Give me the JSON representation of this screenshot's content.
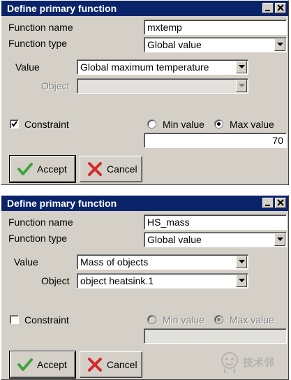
{
  "dialog1": {
    "title": "Define primary function",
    "function_name_label": "Function name",
    "function_name_value": "mxtemp",
    "function_type_label": "Function type",
    "function_type_value": "Global value",
    "value_label": "Value",
    "value_value": "Global maximum temperature",
    "object_label": "Object",
    "object_value": "",
    "object_enabled": false,
    "constraint_label": "Constraint",
    "constraint_checked": true,
    "min_value_label": "Min value",
    "max_value_label": "Max value",
    "selected_bound": "max",
    "bound_value": "70",
    "accept_label": "Accept",
    "cancel_label": "Cancel"
  },
  "dialog2": {
    "title": "Define primary function",
    "function_name_label": "Function name",
    "function_name_value": "HS_mass",
    "function_type_label": "Function type",
    "function_type_value": "Global value",
    "value_label": "Value",
    "value_value": "Mass of objects",
    "object_label": "Object",
    "object_value": "object heatsink.1",
    "object_enabled": true,
    "constraint_label": "Constraint",
    "constraint_checked": false,
    "min_value_label": "Min value",
    "max_value_label": "Max value",
    "selected_bound": "max",
    "bound_value": "",
    "accept_label": "Accept",
    "cancel_label": "Cancel"
  },
  "watermark": {
    "text": "技术邻",
    "icon": "mascot-icon"
  },
  "colors": {
    "title_bar": "#0a246a",
    "face": "#d4d0c8",
    "accept_check": "#3aa63a",
    "cancel_x": "#d42a2a"
  }
}
